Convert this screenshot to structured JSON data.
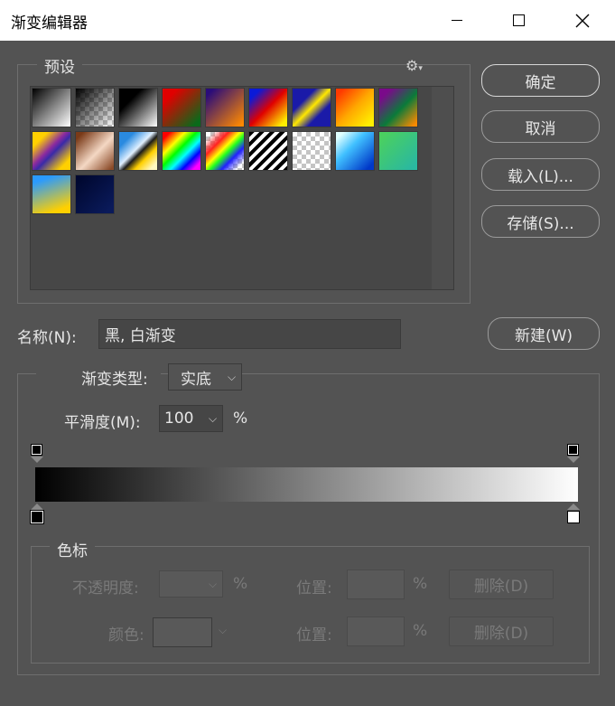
{
  "window": {
    "title": "渐变编辑器"
  },
  "presets": {
    "label": "预设"
  },
  "buttons": {
    "ok": "确定",
    "cancel": "取消",
    "load": "载入(L)...",
    "save": "存储(S)...",
    "new": "新建(W)"
  },
  "name": {
    "label": "名称(N):",
    "value": "黑, 白渐变"
  },
  "gradient": {
    "type_label": "渐变类型:",
    "type_value": "实底",
    "smoothness_label": "平滑度(M):",
    "smoothness_value": "100",
    "smoothness_unit": "%"
  },
  "color_stops": {
    "label": "色标",
    "opacity_label": "不透明度:",
    "opacity_unit": "%",
    "position_label_1": "位置:",
    "position_unit_1": "%",
    "delete_label_1": "删除(D)",
    "color_label": "颜色:",
    "position_label_2": "位置:",
    "position_unit_2": "%",
    "delete_label_2": "删除(D)"
  },
  "colors": {
    "background": "#535353",
    "titlebar": "#ffffff"
  }
}
